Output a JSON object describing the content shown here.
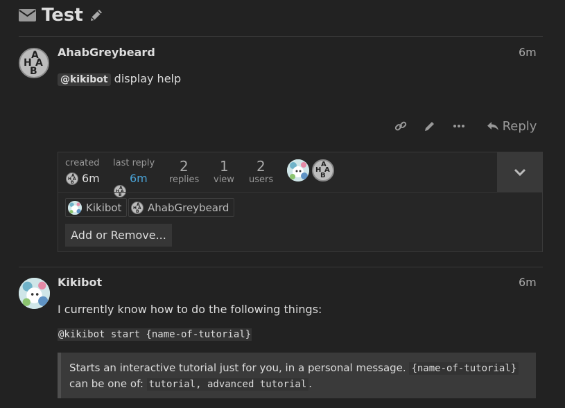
{
  "topic": {
    "title": "Test"
  },
  "post1": {
    "username": "AhabGreybeard",
    "time": "6m",
    "mention": "@kikibot",
    "text": "display help",
    "avatar_letters": [
      "A",
      "H",
      "A",
      "B"
    ],
    "actions": {
      "reply_label": "Reply"
    }
  },
  "topic_map": {
    "created_label": "created",
    "created_time": "6m",
    "last_reply_label": "last reply",
    "last_reply_time": "6m",
    "replies_count": "2",
    "replies_label": "replies",
    "views_count": "1",
    "views_label": "view",
    "users_count": "2",
    "users_label": "users",
    "participants": [
      {
        "name": "Kikibot"
      },
      {
        "name": "AhabGreybeard"
      }
    ],
    "add_remove_label": "Add or Remove..."
  },
  "post2": {
    "username": "Kikibot",
    "time": "6m",
    "intro": "I currently know how to do the following things:",
    "command": "@kikibot start {name-of-tutorial}",
    "quote_text_1": "Starts an interactive tutorial just for you, in a personal message.",
    "quote_code_1": "{name-of-tutorial}",
    "quote_text_2": "can be one of:",
    "quote_code_2": "tutorial, advanced tutorial",
    "quote_end": "."
  },
  "colors": {
    "background": "#222222",
    "text": "#dddddd",
    "muted": "#999999",
    "link": "#4aa3d7"
  }
}
